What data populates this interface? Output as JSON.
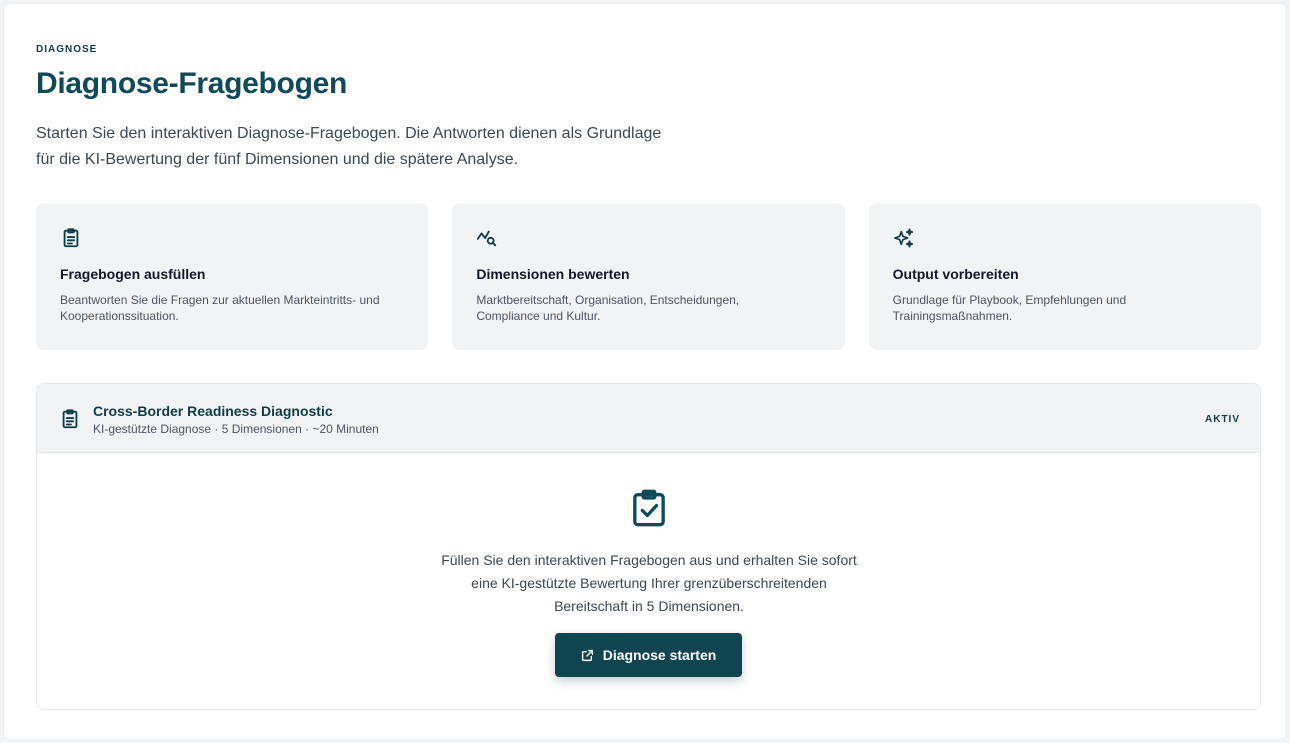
{
  "header": {
    "eyebrow": "DIAGNOSE",
    "title": "Diagnose-Fragebogen",
    "intro_line1": "Starten Sie den interaktiven Diagnose-Fragebogen. Die Antworten dienen als Grundlage",
    "intro_line2": "für die KI-Bewertung der fünf Dimensionen und die spätere Analyse."
  },
  "cards": [
    {
      "icon": "clipboard-icon",
      "title": "Fragebogen ausfüllen",
      "desc_line1": "Beantworten Sie die Fragen zur aktuellen Markteintritts- und",
      "desc_line2": "Kooperationssituation."
    },
    {
      "icon": "chart-search-icon",
      "title": "Dimensionen bewerten",
      "desc_line1": "Marktbereitschaft, Organisation, Entscheidungen,",
      "desc_line2": "Compliance und Kultur."
    },
    {
      "icon": "sparkles-icon",
      "title": "Output vorbereiten",
      "desc_line1": "Grundlage für Playbook, Empfehlungen und",
      "desc_line2": "Trainingsmaßnahmen."
    }
  ],
  "panel": {
    "icon": "clipboard-icon",
    "title": "Cross-Border Readiness Diagnostic",
    "subtitle": "KI-gestützte Diagnose · 5 Dimensionen · ~20 Minuten",
    "status": "AKTIV",
    "body_icon": "clipboard-check-icon",
    "body_line1": "Füllen Sie den interaktiven Fragebogen aus und erhalten Sie sofort",
    "body_line2": "eine KI-gestützte Bewertung Ihrer grenzüberschreitenden",
    "body_line3": "Bereitschaft in 5 Dimensionen.",
    "button_label": "Diagnose starten",
    "button_icon": "external-link-icon"
  },
  "colors": {
    "primary": "#0f4a5a",
    "button": "#0f4450",
    "card_bg": "#f2f3f5"
  }
}
